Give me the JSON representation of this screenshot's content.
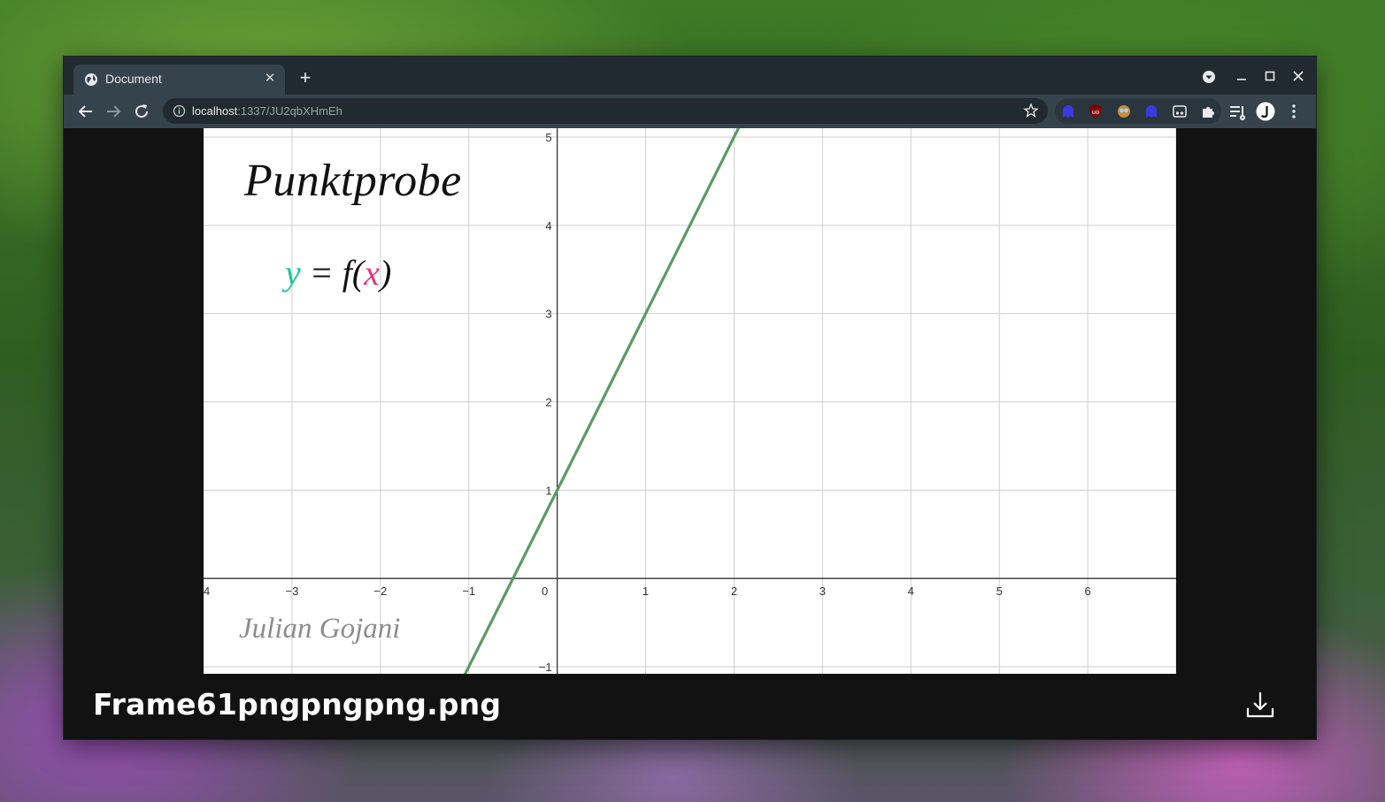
{
  "browser": {
    "tab": {
      "title": "Document",
      "close": "✕"
    },
    "new_tab": "+",
    "address": {
      "host": "localhost",
      "path": ":1337/JU2qbXHmEh"
    },
    "extensions": [
      "blue-ghost-icon",
      "ublock-icon",
      "owl-icon",
      "blue-ghost-icon-2",
      "film-icon",
      "puzzle-icon",
      "reading-list-icon",
      "avatar-icon"
    ]
  },
  "viewer": {
    "filename": "Frame61pngpngpng.png"
  },
  "figure": {
    "title": "Punktprobe",
    "formula": {
      "y": "y",
      "equals": " = ",
      "f_open": "f(",
      "x": "x",
      "close": ")"
    },
    "author": "Julian Gojani"
  },
  "chart_data": {
    "type": "line",
    "x_ticks": [
      "4",
      "−3",
      "−2",
      "−1",
      "0",
      "1",
      "2",
      "3",
      "4",
      "5",
      "6"
    ],
    "y_ticks": [
      "5",
      "4",
      "3",
      "2",
      "1",
      "−1"
    ],
    "xlim": [
      -4,
      7
    ],
    "ylim": [
      -1.08,
      5.1
    ],
    "grid": true,
    "series": [
      {
        "x": [
          -1.1,
          2.1
        ],
        "y": [
          -1.2,
          5.2
        ],
        "color": "#5c9a64"
      }
    ],
    "colors": {
      "line": "#5c9a64",
      "grid": "#cfcfcf",
      "axis": "#333333"
    }
  }
}
